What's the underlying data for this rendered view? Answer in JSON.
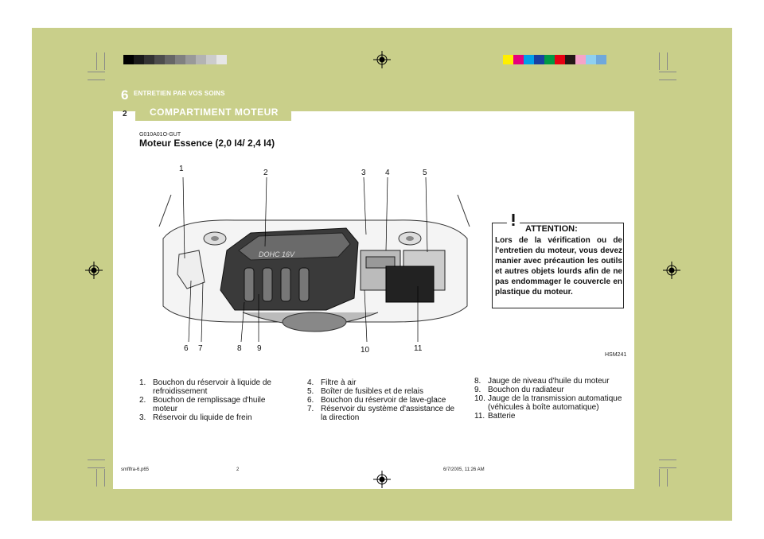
{
  "header": {
    "chapter_number": "6",
    "chapter_title": "ENTRETIEN PAR VOS SOINS",
    "page_number": "2",
    "section_tab": "COMPARTIMENT MOTEUR"
  },
  "section": {
    "code": "G010A01O-GUT",
    "heading": "Moteur Essence (2,0 I4/ 2,4 I4)"
  },
  "figure": {
    "image_code": "HSM241",
    "callouts": [
      "1",
      "2",
      "3",
      "4",
      "5",
      "6",
      "7",
      "8",
      "9",
      "10",
      "11"
    ],
    "engine_label": "DOHC 16V"
  },
  "warning": {
    "title": "ATTENTION:",
    "text": "Lors de la vérification ou de l'entretien du moteur, vous devez manier avec précaution les outils et autres objets lourds afin de ne pas endommager le couvercle en plastique du moteur."
  },
  "legend": {
    "column1": [
      {
        "num": "1.",
        "text": "Bouchon du réservoir à liquide de refroidissement"
      },
      {
        "num": "2.",
        "text": "Bouchon de remplissage d'huile moteur"
      },
      {
        "num": "3.",
        "text": "Réservoir du liquide de frein"
      }
    ],
    "column2": [
      {
        "num": "4.",
        "text": "Filtre à air"
      },
      {
        "num": "5.",
        "text": "Boîter de fusibles et de relais"
      },
      {
        "num": "6.",
        "text": "Bouchon du réservoir de lave-glace"
      },
      {
        "num": "7.",
        "text": "Réservoir du système d'assistance de la direction"
      }
    ],
    "column3": [
      {
        "num": "8.",
        "text": "Jauge de niveau d'huile du moteur"
      },
      {
        "num": "9.",
        "text": "Bouchon du radiateur"
      },
      {
        "num": "10.",
        "text": "Jauge de la transmission automatique (véhicules à boîte automatique)"
      },
      {
        "num": "11.",
        "text": "Batterie"
      }
    ]
  },
  "footer": {
    "file": "smflfra-6.p65",
    "page": "2",
    "timestamp": "6/7/2005, 11:26 AM"
  },
  "colors": {
    "background_band": "#c9cf8a",
    "left_bar": [
      "#000000",
      "#1a1a1a",
      "#333333",
      "#4d4d4d",
      "#666666",
      "#808080",
      "#999999",
      "#b3b3b3",
      "#cccccc",
      "#e6e6e6"
    ],
    "right_bar": [
      "#ffef00",
      "#e6007e",
      "#00a0e9",
      "#1a3fa0",
      "#009944",
      "#e60012",
      "#231815",
      "#f5a3c7",
      "#8fd0f0",
      "#6fa8dc"
    ]
  }
}
